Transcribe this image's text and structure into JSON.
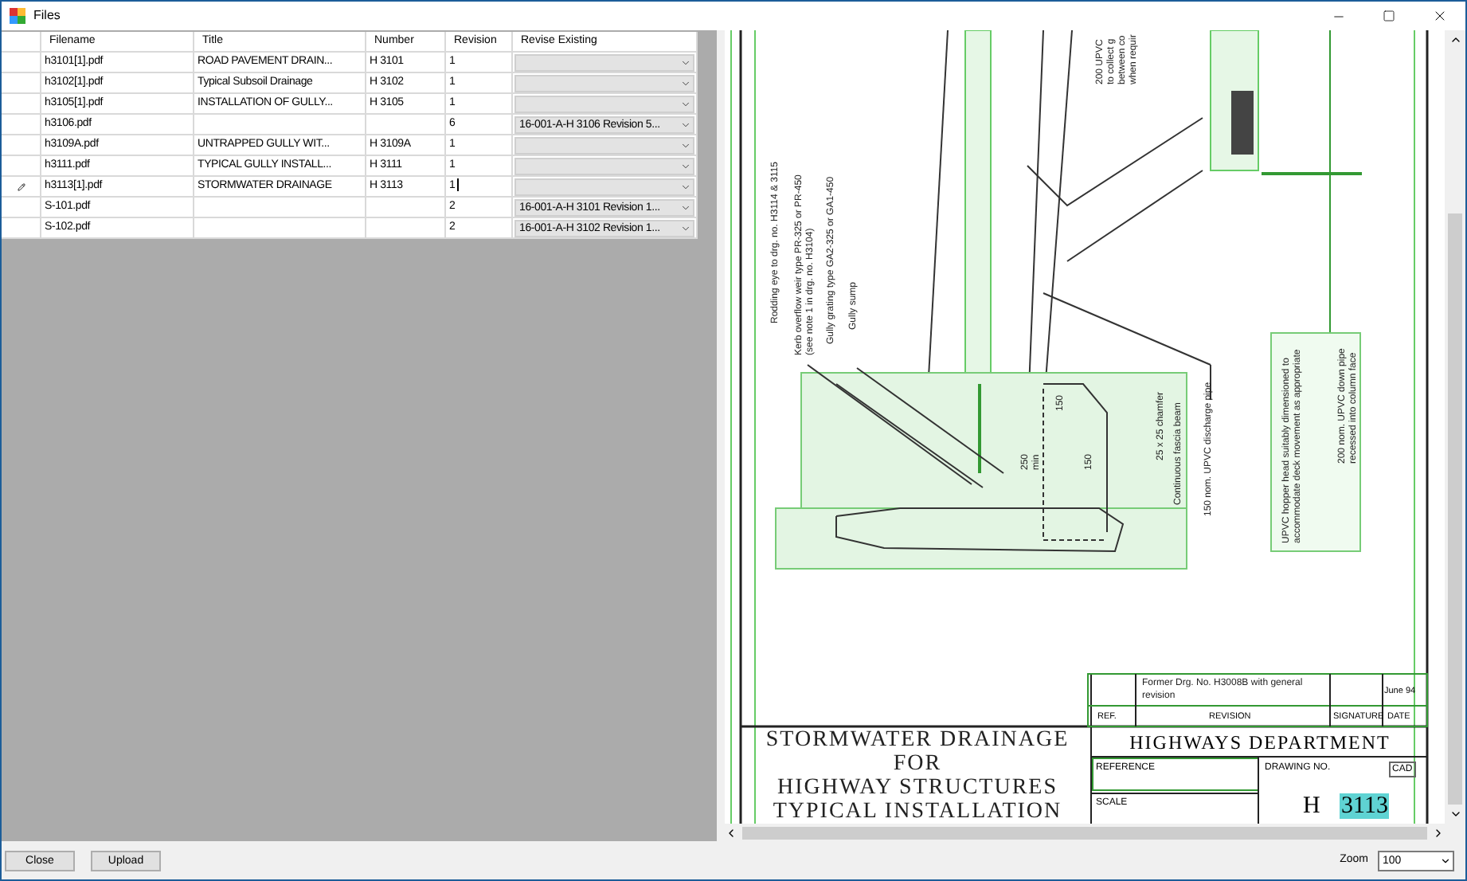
{
  "window": {
    "title": "Files"
  },
  "table": {
    "columns": [
      "Filename",
      "Title",
      "Number",
      "Revision",
      "Revise Existing"
    ],
    "rows": [
      {
        "filename": "h3101[1].pdf",
        "title": "ROAD PAVEMENT DRAIN...",
        "number": "H 3101",
        "revision": "1",
        "editing": false
      },
      {
        "filename": "h3102[1].pdf",
        "title": "Typical Subsoil Drainage",
        "number": "H 3102",
        "revision": "1",
        "editing": false
      },
      {
        "filename": "h3105[1].pdf",
        "title": "INSTALLATION OF GULLY...",
        "number": "H 3105",
        "revision": "1",
        "editing": false
      },
      {
        "filename": "h3106.pdf",
        "revision": "6",
        "revise_existing": "16-001-A-H 3106 Revision 5...",
        "editing": false
      },
      {
        "filename": "h3109A.pdf",
        "title": "UNTRAPPED GULLY WIT...",
        "number": "H 3109A",
        "revision": "1",
        "editing": false
      },
      {
        "filename": "h3111.pdf",
        "title": "TYPICAL GULLY INSTALL...",
        "number": "H 3111",
        "revision": "1",
        "editing": false
      },
      {
        "filename": "h3113[1].pdf",
        "title": "STORMWATER DRAINAGE",
        "number": "H 3113",
        "revision": "1",
        "editing": true
      },
      {
        "filename": "S-101.pdf",
        "revision": "2",
        "revise_existing": "16-001-A-H 3101 Revision 1...",
        "editing": false
      },
      {
        "filename": "S-102.pdf",
        "revision": "2",
        "revise_existing": "16-001-A-H 3102 Revision 1...",
        "editing": false
      }
    ]
  },
  "viewer": {
    "notes": [
      {
        "lines": [
          "Rodding eye to drg. no. H3114 & 3115"
        ]
      },
      {
        "lines": [
          "Kerb overflow weir type PR-325 or PR-450",
          "(see note 1 in drg. no. H3104)"
        ]
      },
      {
        "lines": [
          "Gully grating type GA2-325 or GA1-450"
        ]
      },
      {
        "lines": [
          "Gully sump"
        ]
      },
      {
        "lines": [
          "200 UPVC",
          "to collect g",
          "between co",
          "when requir"
        ]
      },
      {
        "lines": [
          "25 x 25 chamfer"
        ]
      },
      {
        "lines": [
          "Continuous fascia beam"
        ]
      },
      {
        "lines": [
          "150 nom. UPVC discharge pipe"
        ]
      },
      {
        "lines": [
          "150"
        ]
      },
      {
        "lines": [
          "250",
          "min"
        ]
      },
      {
        "lines": [
          "150"
        ]
      },
      {
        "lines": [
          "UPVC hopper head suitably dimensioned to",
          "accommodate deck movement as appropriate"
        ]
      },
      {
        "lines": [
          "200 nom. UPVC down pipe",
          "recessed into column face"
        ]
      }
    ],
    "title_block": {
      "revision_entry": [
        "Former Drg. No. H3008B with general",
        "revision"
      ],
      "revision_date": "June 94",
      "revision_headers": [
        "REF.",
        "REVISION",
        "SIGNATURE",
        "DATE"
      ],
      "title_lines": [
        "STORMWATER DRAINAGE",
        "FOR",
        "HIGHWAY STRUCTURES",
        "TYPICAL INSTALLATION"
      ],
      "department": "HIGHWAYS DEPARTMENT",
      "reference_label": "REFERENCE",
      "drawing_no_label": "DRAWING NO.",
      "cad_label": "CAD",
      "scale_label": "SCALE",
      "drawing_prefix": "H",
      "drawing_number": "3113"
    }
  },
  "buttons": [
    "Close",
    "Upload"
  ],
  "zoom": {
    "label": "Zoom",
    "value": "100"
  }
}
